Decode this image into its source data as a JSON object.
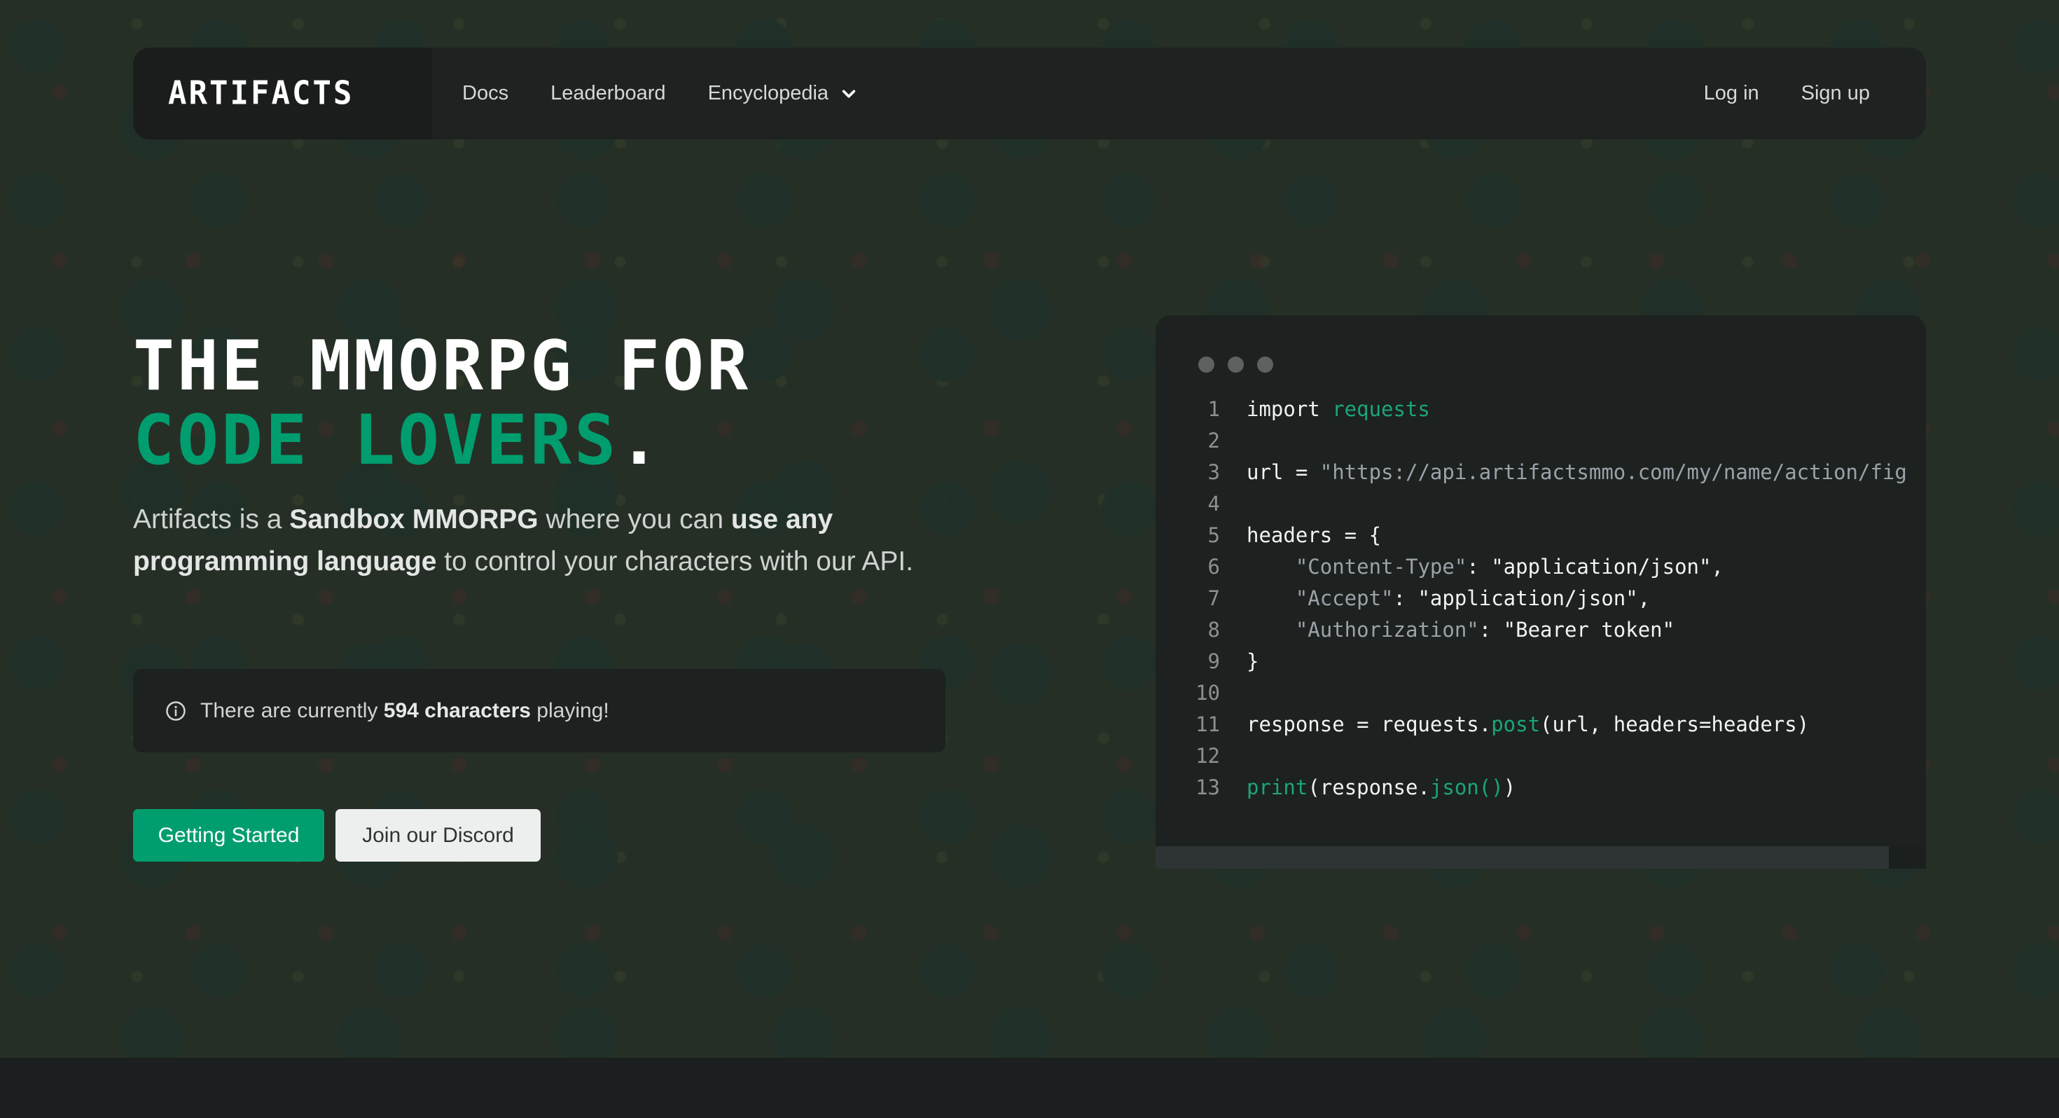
{
  "nav": {
    "logo": "ARTIFACTS",
    "links": [
      {
        "label": "Docs"
      },
      {
        "label": "Leaderboard"
      },
      {
        "label": "Encyclopedia",
        "has_dropdown": true
      }
    ],
    "login": "Log in",
    "signup": "Sign up"
  },
  "hero": {
    "heading_line1": "THE MMORPG FOR",
    "heading_line2": "CODE LOVERS",
    "heading_punct": ".",
    "lead": {
      "t1": "Artifacts is a ",
      "b1": "Sandbox MMORPG",
      "t2": " where you can ",
      "b2": "use any programming language",
      "t3": " to control your characters with our API."
    },
    "info": {
      "icon": "info-circle-icon",
      "prefix": "There are currently ",
      "count_text": "594 characters",
      "suffix": " playing!"
    },
    "buttons": {
      "primary": "Getting Started",
      "secondary": "Join our Discord"
    }
  },
  "code_panel": {
    "window_dots": 3,
    "lines": [
      {
        "n": "1",
        "tokens": [
          {
            "t": "import ",
            "c": "white"
          },
          {
            "t": "requests",
            "c": "green"
          }
        ]
      },
      {
        "n": "2",
        "tokens": []
      },
      {
        "n": "3",
        "tokens": [
          {
            "t": "url = ",
            "c": "white"
          },
          {
            "t": "\"https://api.artifactsmmo.com/my/name/action/fig",
            "c": "str"
          }
        ]
      },
      {
        "n": "4",
        "tokens": []
      },
      {
        "n": "5",
        "tokens": [
          {
            "t": "headers = {",
            "c": "white"
          }
        ]
      },
      {
        "n": "6",
        "tokens": [
          {
            "t": "    ",
            "c": "white"
          },
          {
            "t": "\"Content-Type\"",
            "c": "str"
          },
          {
            "t": ": \"application/json\",",
            "c": "white"
          }
        ]
      },
      {
        "n": "7",
        "tokens": [
          {
            "t": "    ",
            "c": "white"
          },
          {
            "t": "\"Accept\"",
            "c": "str"
          },
          {
            "t": ": \"application/json\",",
            "c": "white"
          }
        ]
      },
      {
        "n": "8",
        "tokens": [
          {
            "t": "    ",
            "c": "white"
          },
          {
            "t": "\"Authorization\"",
            "c": "str"
          },
          {
            "t": ": \"Bearer token\"",
            "c": "white"
          }
        ]
      },
      {
        "n": "9",
        "tokens": [
          {
            "t": "}",
            "c": "white"
          }
        ]
      },
      {
        "n": "10",
        "tokens": []
      },
      {
        "n": "11",
        "tokens": [
          {
            "t": "response = requests.",
            "c": "white"
          },
          {
            "t": "post",
            "c": "green"
          },
          {
            "t": "(url, headers=headers)",
            "c": "white"
          }
        ]
      },
      {
        "n": "12",
        "tokens": []
      },
      {
        "n": "13",
        "tokens": [
          {
            "t": "print",
            "c": "green"
          },
          {
            "t": "(response.",
            "c": "white"
          },
          {
            "t": "json()",
            "c": "green"
          },
          {
            "t": ")",
            "c": "white"
          }
        ]
      }
    ]
  },
  "colors": {
    "accent": "#009e6e",
    "background": "#262f26",
    "panel": "#1d2120",
    "footer": "#1b1f1f"
  }
}
